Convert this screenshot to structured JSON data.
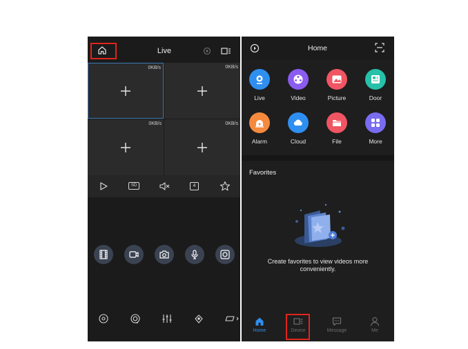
{
  "left_screen": {
    "title": "Live",
    "grid_cells": [
      {
        "rate": "0KB/s"
      },
      {
        "rate": "0KB/s"
      },
      {
        "rate": "0KB/s"
      },
      {
        "rate": "0KB/s"
      }
    ],
    "controls": {
      "sd_label": "SD",
      "split_label": "4"
    }
  },
  "right_screen": {
    "title": "Home",
    "apps": [
      {
        "label": "Live",
        "icon": "live-icon",
        "color": "#2f8ff0"
      },
      {
        "label": "Video",
        "icon": "video-reel-icon",
        "color": "#8a5cf0"
      },
      {
        "label": "Picture",
        "icon": "picture-icon",
        "color": "#f05563"
      },
      {
        "label": "Door",
        "icon": "door-icon",
        "color": "#27c0a8"
      },
      {
        "label": "Alarm",
        "icon": "alarm-icon",
        "color": "#f58a3e"
      },
      {
        "label": "Cloud",
        "icon": "cloud-icon",
        "color": "#2f8ff0"
      },
      {
        "label": "File",
        "icon": "file-icon",
        "color": "#f05563"
      },
      {
        "label": "More",
        "icon": "more-icon",
        "color": "#7a6cf0"
      }
    ],
    "favorites_title": "Favorites",
    "empty_message": "Create favorites to view videos more conveniently.",
    "tabs": [
      {
        "label": "Home",
        "icon": "home-icon",
        "active": true
      },
      {
        "label": "Device",
        "icon": "device-icon",
        "active": false
      },
      {
        "label": "Message",
        "icon": "message-icon",
        "active": false
      },
      {
        "label": "Me",
        "icon": "person-icon",
        "active": false
      }
    ]
  },
  "colors": {
    "highlight": "#e1251b",
    "accent": "#2f8ff0"
  }
}
